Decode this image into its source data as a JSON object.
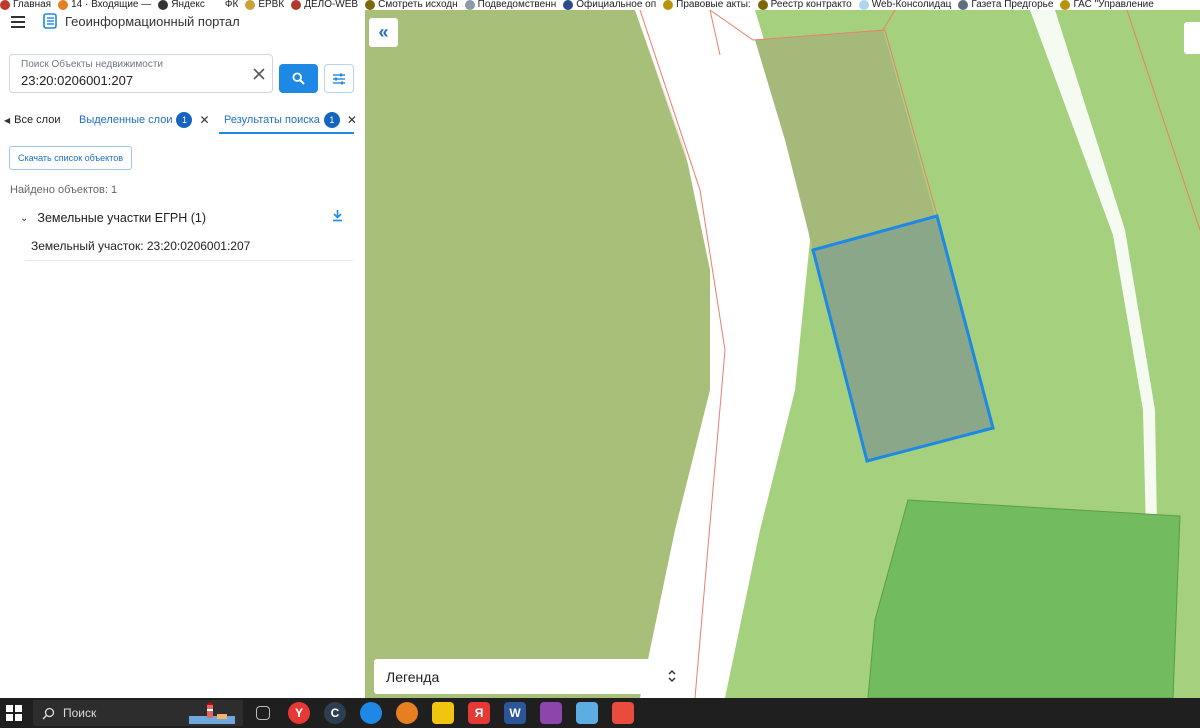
{
  "browser": {
    "bookmarks": [
      {
        "label": "Главная",
        "icon": "flag-icon",
        "color": "#c0392b"
      },
      {
        "label": "14 · Входящие —",
        "icon": "mail-icon",
        "color": "#e67e22"
      },
      {
        "label": "Яндекс",
        "icon": "plus-icon",
        "color": "#333333"
      },
      {
        "label": "ФК",
        "icon": "folder-icon",
        "color": "#ffffff"
      },
      {
        "label": "ЕРВК",
        "icon": "emblem-icon",
        "color": "#c8a23a"
      },
      {
        "label": "ДЕЛО-WEB",
        "icon": "emblem-icon",
        "color": "#b03a2e"
      },
      {
        "label": "Смотреть исходн",
        "icon": "page-icon",
        "color": "#7d6608"
      },
      {
        "label": "Подведомственн",
        "icon": "emblem-icon",
        "color": "#8e9aa6"
      },
      {
        "label": "Официальное оп",
        "icon": "flag-icon",
        "color": "#2e4a8a"
      },
      {
        "label": "Правовые акты:",
        "icon": "emblem-icon",
        "color": "#b7950b"
      },
      {
        "label": "Реестр контракто",
        "icon": "emblem-icon",
        "color": "#7d6608"
      },
      {
        "label": "Web-Консолидац",
        "icon": "cloud-icon",
        "color": "#aed6f1"
      },
      {
        "label": "Газета Предгорье",
        "icon": "page-icon",
        "color": "#5d6d7e"
      },
      {
        "label": "ГАС \"Управление",
        "icon": "emblem-icon",
        "color": "#b7950b"
      }
    ]
  },
  "app": {
    "title": "Геоинформационный портал",
    "accent_color": "#1e88e5"
  },
  "search": {
    "label": "Поиск Объекты недвижимости",
    "value": "23:20:0206001:207"
  },
  "tabs": {
    "all": "Все слои",
    "selected": {
      "label": "Выделенные слои",
      "count": "1"
    },
    "results": {
      "label": "Результаты поиска",
      "count": "1"
    }
  },
  "results": {
    "download_label": "Скачать список объектов",
    "found_text": "Найдено объектов: 1",
    "groups": [
      {
        "title": "Земельные участки ЕГРН (1)",
        "items": [
          "Земельный участок: 23:20:0206001:207"
        ]
      }
    ]
  },
  "map": {
    "legend_label": "Легенда",
    "colors": {
      "dark_green": "#a8bf79",
      "light_green": "#a5d07e",
      "road": "#ffffff",
      "highlight_border": "#1e88e5",
      "highlight_fill": "#8aa889",
      "parcel_green": "#72bb5e",
      "boundary": "#e8806a"
    }
  },
  "taskbar": {
    "search_placeholder": "Поиск",
    "apps": [
      {
        "name": "task-view-icon",
        "label": ""
      },
      {
        "name": "yandex-browser-icon",
        "label": "Y"
      },
      {
        "name": "ccleaner-icon",
        "label": "C"
      },
      {
        "name": "edge-icon",
        "label": ""
      },
      {
        "name": "firefox-icon",
        "label": ""
      },
      {
        "name": "file-explorer-icon",
        "label": ""
      },
      {
        "name": "yandex-icon",
        "label": "Я"
      },
      {
        "name": "word-icon",
        "label": "W"
      },
      {
        "name": "winrar-icon",
        "label": ""
      },
      {
        "name": "notes-icon",
        "label": ""
      },
      {
        "name": "app-red-icon",
        "label": ""
      }
    ]
  }
}
